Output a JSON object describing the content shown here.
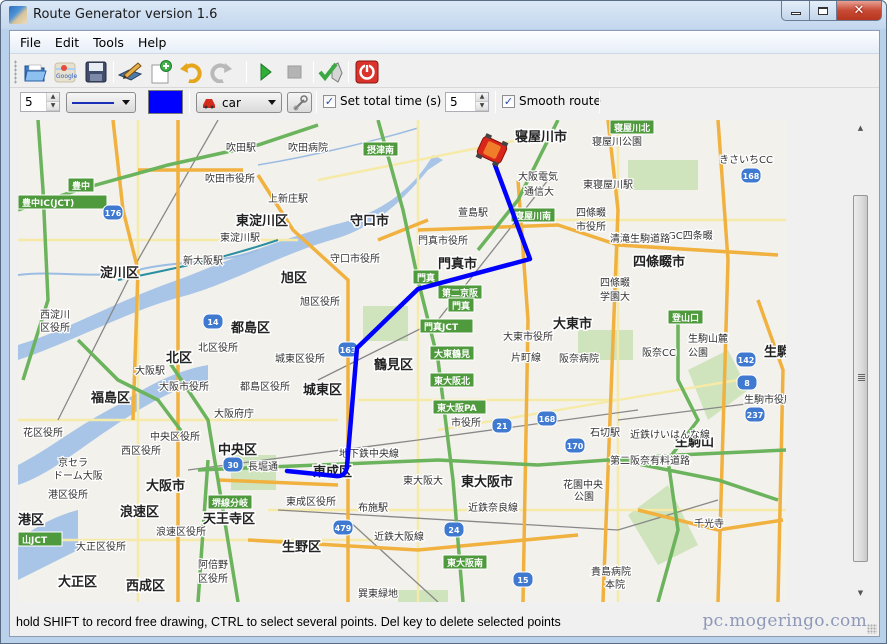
{
  "window": {
    "title": "Route Generator version 1.6",
    "controls": {
      "minimize": "minimize",
      "maximize": "maximize",
      "close": "✕"
    }
  },
  "menu": [
    "File",
    "Edit",
    "Tools",
    "Help"
  ],
  "toolbar": {
    "buttons": [
      {
        "name": "open-file",
        "icon": "folder-open-icon"
      },
      {
        "name": "google-maps",
        "icon": "google-maps-icon"
      },
      {
        "name": "save",
        "icon": "floppy-disk-icon"
      },
      {
        "name": "edit-route",
        "icon": "pencil-pad-icon"
      },
      {
        "name": "new-route",
        "icon": "new-document-icon"
      },
      {
        "name": "undo",
        "icon": "undo-icon"
      },
      {
        "name": "redo",
        "icon": "redo-icon"
      },
      {
        "name": "play",
        "icon": "play-icon"
      },
      {
        "name": "stop",
        "icon": "stop-icon"
      },
      {
        "name": "export",
        "icon": "check-export-icon"
      },
      {
        "name": "power",
        "icon": "power-icon"
      }
    ]
  },
  "options": {
    "line_width": "5",
    "line_style": "solid",
    "line_color": "#0000ff",
    "vehicle": "car",
    "set_total_time_label": "Set total time (s) :",
    "set_total_time_checked": true,
    "total_time": "5",
    "smooth_route_label": "Smooth route",
    "smooth_route_checked": true,
    "check_mark": "✓"
  },
  "map": {
    "route_color": "#0000ff",
    "labels_big": [
      {
        "t": "東淀川区"
      },
      {
        "t": "淀川区"
      },
      {
        "t": "守口市"
      },
      {
        "t": "旭区"
      },
      {
        "t": "門真市"
      },
      {
        "t": "寝屋川市"
      },
      {
        "t": "四條畷市"
      },
      {
        "t": "都島区"
      },
      {
        "t": "北区"
      },
      {
        "t": "福島区"
      },
      {
        "t": "城東区"
      },
      {
        "t": "鶴見区"
      },
      {
        "t": "大東市"
      },
      {
        "t": "中央区"
      },
      {
        "t": "東成区"
      },
      {
        "t": "東大阪市"
      },
      {
        "t": "大阪市"
      },
      {
        "t": "浪速区"
      },
      {
        "t": "天王寺区"
      },
      {
        "t": "生野区"
      },
      {
        "t": "大正区"
      },
      {
        "t": "西成区"
      },
      {
        "t": "港区"
      },
      {
        "t": "生駒山"
      },
      {
        "t": "生駒"
      }
    ],
    "labels_small": [
      {
        "t": "吹田駅"
      },
      {
        "t": "吹田病院"
      },
      {
        "t": "吹田市役所"
      },
      {
        "t": "上新庄駅"
      },
      {
        "t": "東淀川駅"
      },
      {
        "t": "新大阪駅"
      },
      {
        "t": "守口市役所"
      },
      {
        "t": "門真市役所"
      },
      {
        "t": "旭区役所"
      },
      {
        "t": "萱島駅"
      },
      {
        "t": "大阪電気"
      },
      {
        "t": "通信大"
      },
      {
        "t": "寝屋川公園"
      },
      {
        "t": "東寝屋川駅"
      },
      {
        "t": "四條畷"
      },
      {
        "t": "市役所"
      },
      {
        "t": "GC四条畷"
      },
      {
        "t": "きさいちCC"
      },
      {
        "t": "四條畷"
      },
      {
        "t": "学園大"
      },
      {
        "t": "西淀川"
      },
      {
        "t": "区役所"
      },
      {
        "t": "北区役所"
      },
      {
        "t": "大阪駅"
      },
      {
        "t": "大阪市役所"
      },
      {
        "t": "都島区役所"
      },
      {
        "t": "城東区役所"
      },
      {
        "t": "大阪府庁"
      },
      {
        "t": "中央区役所"
      },
      {
        "t": "西区役所"
      },
      {
        "t": "京セラ"
      },
      {
        "t": "ドーム大阪"
      },
      {
        "t": "港区役所"
      },
      {
        "t": "花区役所"
      },
      {
        "t": "大東市役所"
      },
      {
        "t": "片町線"
      },
      {
        "t": "阪奈病院"
      },
      {
        "t": "東大阪"
      },
      {
        "t": "市役所"
      },
      {
        "t": "地下鉄中央線"
      },
      {
        "t": "東大阪大"
      },
      {
        "t": "布施駅"
      },
      {
        "t": "近鉄奈良線"
      },
      {
        "t": "花園中央"
      },
      {
        "t": "公園"
      },
      {
        "t": "石切駅"
      },
      {
        "t": "阪奈CC"
      },
      {
        "t": "生駒山麓"
      },
      {
        "t": "公園"
      },
      {
        "t": "生駒市役所"
      },
      {
        "t": "近鉄けいはんな線"
      },
      {
        "t": "第二阪奈有料道路"
      },
      {
        "t": "清滝生駒道路"
      },
      {
        "t": "千光寺"
      },
      {
        "t": "貴島病院"
      },
      {
        "t": "本院"
      },
      {
        "t": "巽東緑地"
      },
      {
        "t": "浪速区役所"
      },
      {
        "t": "大正区役所"
      },
      {
        "t": "阿倍野"
      },
      {
        "t": "区役所"
      },
      {
        "t": "東成区役所"
      },
      {
        "t": "西成区役所"
      },
      {
        "t": "長堀通"
      },
      {
        "t": "近鉄大阪線"
      }
    ],
    "highway_signs": [
      "摂津南",
      "豊中",
      "豊中IC(JCT)",
      "寝屋川北",
      "寝屋川南",
      "門真",
      "第二京阪",
      "門真",
      "門真JCT",
      "大東鶴見",
      "東大阪北",
      "東大阪PA",
      "登山口",
      "堺線分岐",
      "東大阪南",
      "山JCT"
    ],
    "route_shields": [
      "176",
      "14",
      "163",
      "168",
      "21",
      "170",
      "237",
      "142",
      "8",
      "30",
      "479",
      "24",
      "15",
      "168"
    ]
  },
  "statusbar": {
    "text": "hold SHIFT to record free drawing, CTRL to select several points. Del key to delete selected points"
  },
  "watermark": "pc.mogeringo.com"
}
